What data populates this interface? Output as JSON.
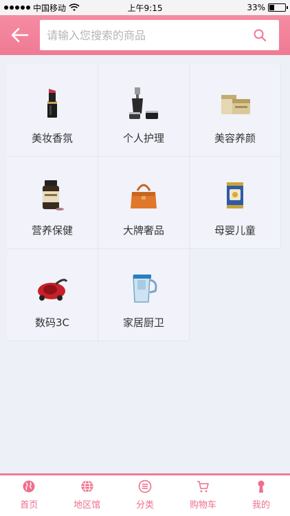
{
  "status_bar": {
    "carrier": "中国移动",
    "time": "上午9:15",
    "battery": "33%",
    "battery_level": 0.33
  },
  "header": {
    "search_placeholder": "请输入您搜索的商品"
  },
  "categories": [
    {
      "label": "美妆香氛",
      "icon": "lipstick-icon"
    },
    {
      "label": "个人护理",
      "icon": "skincare-bottles-icon"
    },
    {
      "label": "美容养颜",
      "icon": "cream-jar-icon"
    },
    {
      "label": "营养保健",
      "icon": "supplement-bottle-icon"
    },
    {
      "label": "大牌奢品",
      "icon": "handbag-icon"
    },
    {
      "label": "母婴儿童",
      "icon": "formula-can-icon"
    },
    {
      "label": "数码3C",
      "icon": "vacuum-icon"
    },
    {
      "label": "家居厨卫",
      "icon": "water-pitcher-icon"
    }
  ],
  "bottom_nav": [
    {
      "label": "首页",
      "icon": "globe-icon"
    },
    {
      "label": "地区馆",
      "icon": "world-icon"
    },
    {
      "label": "分类",
      "icon": "list-icon"
    },
    {
      "label": "购物车",
      "icon": "cart-icon"
    },
    {
      "label": "我的",
      "icon": "user-icon"
    }
  ],
  "colors": {
    "accent": "#ef7a93",
    "background": "#eef0f8"
  }
}
